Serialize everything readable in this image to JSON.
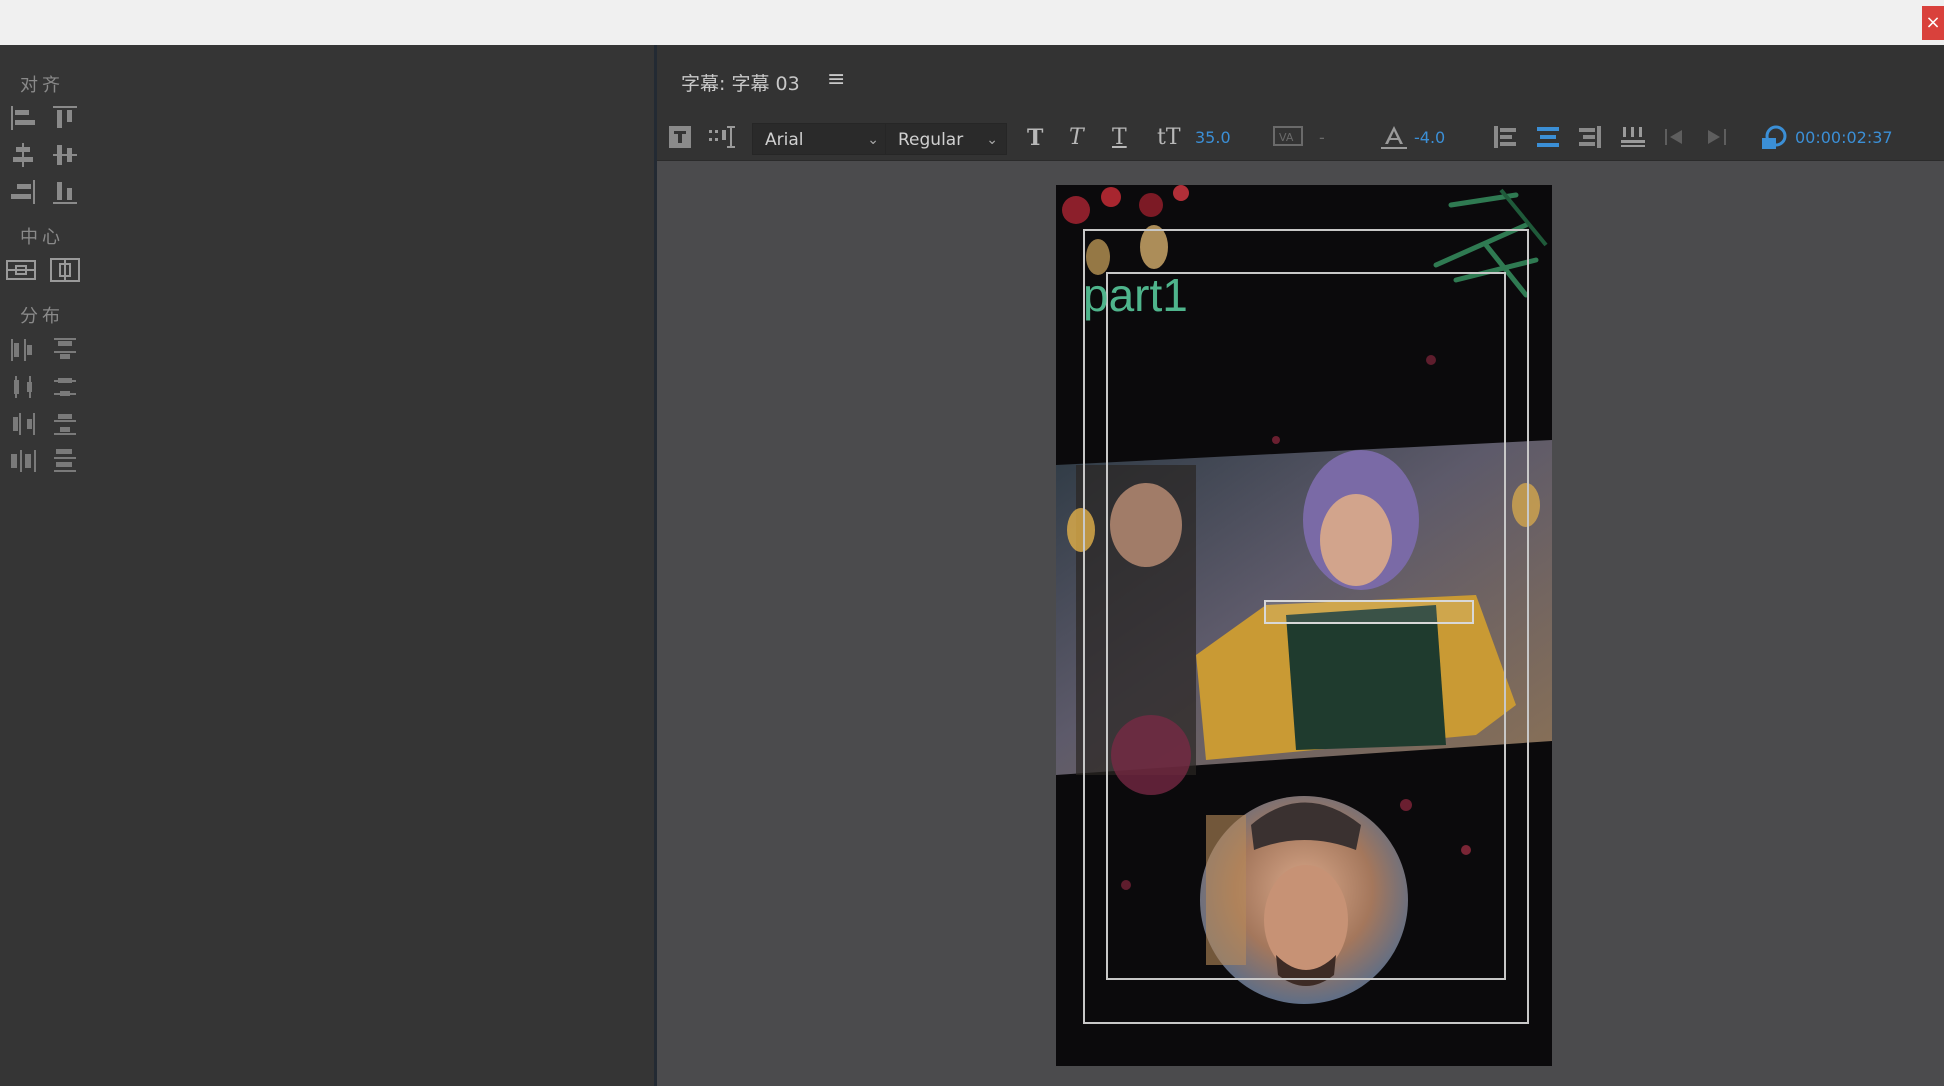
{
  "window": {
    "close_label": "×"
  },
  "align_panel": {
    "align_label": "对齐",
    "center_label": "中心",
    "distribute_label": "分布"
  },
  "title_panel": {
    "title": "字幕: 字幕 03",
    "menu_icon": "≡",
    "font_family": "Arial",
    "font_style": "Regular",
    "font_size": "35.0",
    "kerning": "-",
    "leading": "-4.0",
    "timecode": "00:00:02:37",
    "accent_color": "#3b8fd6"
  },
  "preview": {
    "text": "part1",
    "text_color": "#57c79a"
  }
}
